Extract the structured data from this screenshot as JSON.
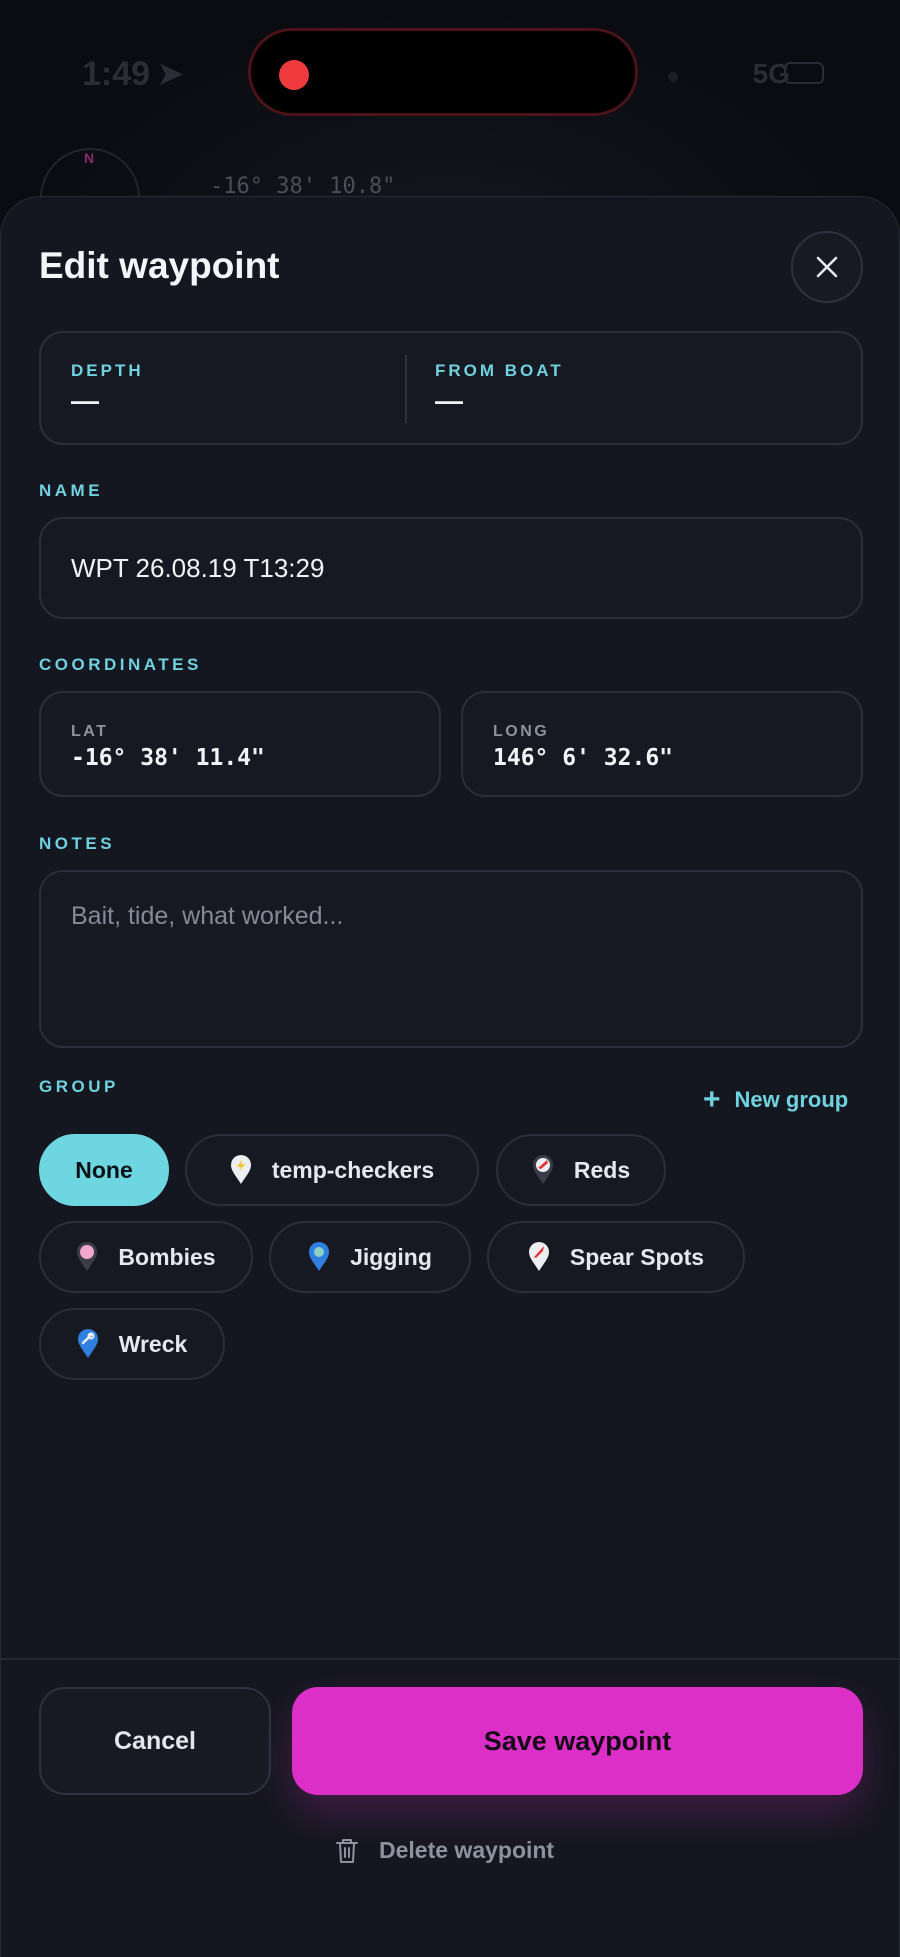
{
  "status_bar": {
    "time": "1:49",
    "network": "5G"
  },
  "map": {
    "coordinate": "-16° 38' 10.8\"",
    "compass_label": "N"
  },
  "sheet": {
    "title": "Edit waypoint",
    "stats": [
      {
        "label": "DEPTH",
        "value": "—"
      },
      {
        "label": "FROM BOAT",
        "value": "—"
      }
    ],
    "name": {
      "label": "NAME",
      "value": "WPT 26.08.19 T13:29"
    },
    "coordinates": {
      "label": "COORDINATES",
      "lat": {
        "label": "LAT",
        "value": "-16° 38' 11.4\""
      },
      "long": {
        "label": "LONG",
        "value": "146° 6' 32.6\""
      }
    },
    "notes": {
      "label": "NOTES",
      "placeholder": "Bait, tide, what worked..."
    },
    "group": {
      "label": "GROUP",
      "new_group": "New group",
      "selected": "None",
      "chips": [
        {
          "label": "None",
          "icon": "none",
          "color": ""
        },
        {
          "label": "temp-checkers",
          "icon": "pin-lightning-icon",
          "color": "#f2d24a"
        },
        {
          "label": "Reds",
          "icon": "pin-fish-icon",
          "color": "#e4333b"
        },
        {
          "label": "Bombies",
          "icon": "pin-circle-icon",
          "color": "#f3a6cf"
        },
        {
          "label": "Jigging",
          "icon": "pin-star-icon",
          "color": "#2f7fe0"
        },
        {
          "label": "Spear Spots",
          "icon": "pin-spear-icon",
          "color": "#e4333b"
        },
        {
          "label": "Wreck",
          "icon": "pin-anchor-icon",
          "color": "#2f7fe0"
        }
      ]
    },
    "buttons": {
      "cancel": "Cancel",
      "save": "Save waypoint",
      "delete": "Delete waypoint"
    }
  },
  "colors": {
    "accent": "#6fd2de",
    "primary": "#db2fc7",
    "background": "#151720"
  }
}
